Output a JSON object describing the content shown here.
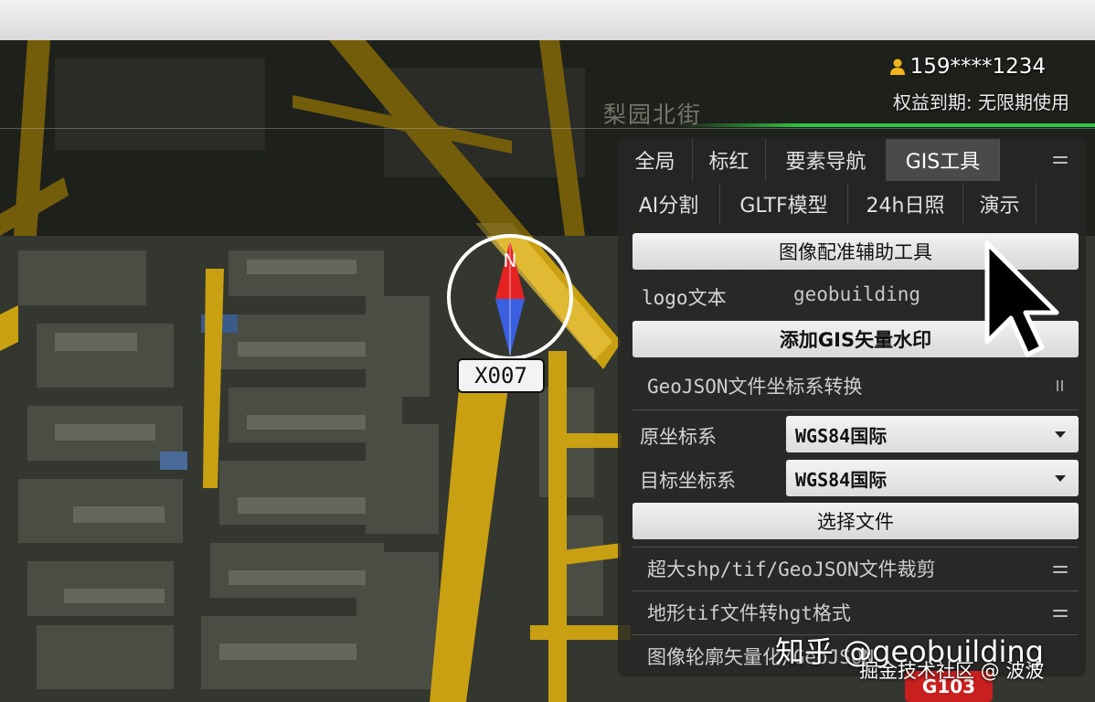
{
  "user": {
    "phone": "159****1234",
    "expire_text": "权益到期: 无限期使用"
  },
  "map": {
    "street_name": "梨园北街",
    "marker_label": "X007",
    "compass_letter": "N",
    "road_badge": "G103"
  },
  "tabs": [
    {
      "label": "全局"
    },
    {
      "label": "标红"
    },
    {
      "label": "要素导航"
    },
    {
      "label": "GIS工具",
      "active": true
    },
    {
      "label": "AI分割"
    },
    {
      "label": "GLTF模型"
    },
    {
      "label": "24h日照"
    },
    {
      "label": "演示"
    }
  ],
  "tools": {
    "image_registration_button": "图像配准辅助工具",
    "logo_label": "logo文本",
    "logo_value": "geobuilding",
    "add_watermark_button": "添加GIS矢量水印",
    "geojson_section_title": "GeoJSON文件坐标系转换",
    "source_crs_label": "原坐标系",
    "source_crs_value": "WGS84国际",
    "target_crs_label": "目标坐标系",
    "target_crs_value": "WGS84国际",
    "choose_file_button": "选择文件",
    "clip_section_title": "超大shp/tif/GeoJSON文件裁剪",
    "hgt_section_title": "地形tif文件转hgt格式",
    "contour_section_title": "图像轮廓矢量化/GeoJSON"
  },
  "watermark": {
    "line1": "知乎 @geobuilding",
    "line2": "掘金技术社区 @ 波波"
  },
  "colors": {
    "road": "#c9a012",
    "panel_bg": "#262626",
    "accent_green": "#30c840",
    "compass_red": "#e52222",
    "compass_blue": "#3a5fe0"
  }
}
